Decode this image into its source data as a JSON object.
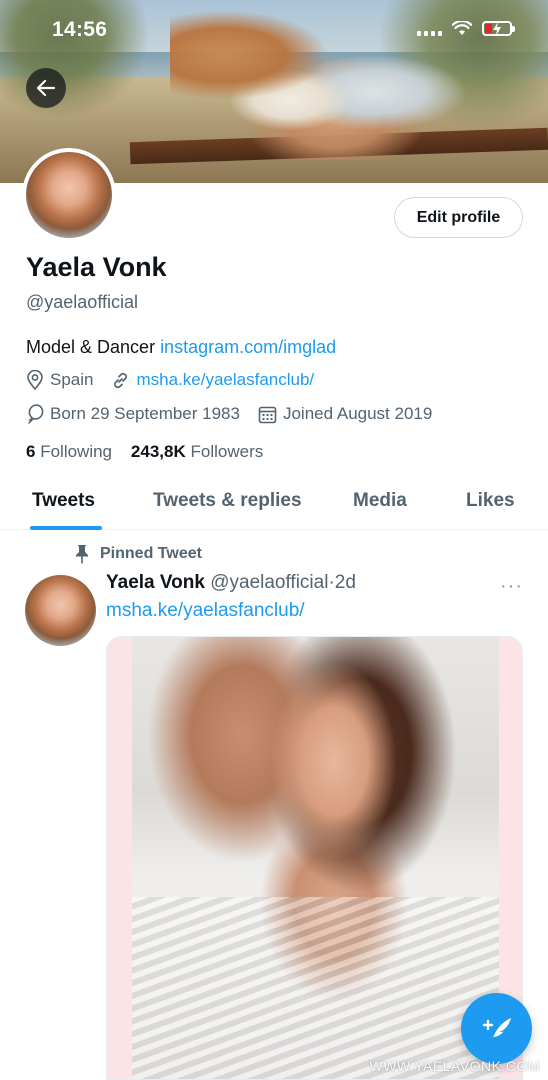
{
  "status_bar": {
    "time": "14:56",
    "icons": [
      "signal-icon",
      "wifi-icon",
      "battery-charging-icon"
    ],
    "battery_color": "#e0262c"
  },
  "header": {
    "back_icon": "arrow-left-icon"
  },
  "profile": {
    "edit_label": "Edit profile",
    "name": "Yaela Vonk",
    "handle": "@yaelaofficial",
    "bio_text": "Model & Dancer ",
    "bio_link": "instagram.com/imglad",
    "location": "Spain",
    "website": "msha.ke/yaelasfanclub/",
    "born": "Born 29 September 1983",
    "joined": "Joined August 2019",
    "following_count": "6",
    "following_label": "Following",
    "followers_count": "243,8K",
    "followers_label": "Followers"
  },
  "tabs": [
    {
      "label": "Tweets",
      "active": true
    },
    {
      "label": "Tweets & replies",
      "active": false
    },
    {
      "label": "Media",
      "active": false
    },
    {
      "label": "Likes",
      "active": false
    }
  ],
  "pinned_tweet": {
    "pinned_label": "Pinned Tweet",
    "author_name": "Yaela Vonk",
    "author_handle": "@yaelaofficial",
    "separator": "·",
    "time": "2d",
    "more": "···",
    "link": "msha.ke/yaelasfanclub/"
  },
  "compose": {
    "icon": "compose-tweet-icon"
  },
  "watermark": "WWW.YAELAVONK.COM",
  "colors": {
    "accent": "#1d9bf0",
    "text_primary": "#0f1419",
    "text_secondary": "#536471"
  }
}
